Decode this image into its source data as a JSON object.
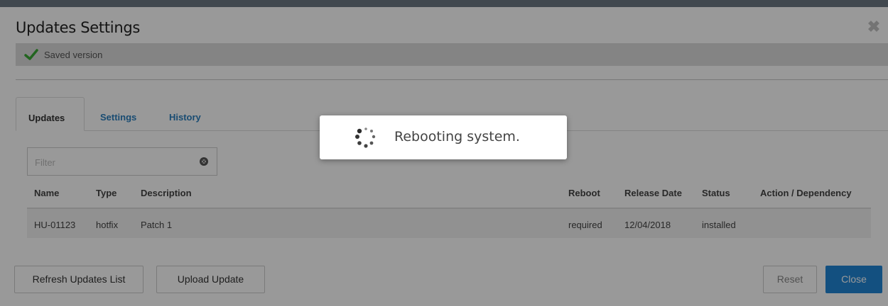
{
  "dialog": {
    "title": "Updates Settings",
    "saved_status": "Saved version"
  },
  "tabs": [
    {
      "label": "Updates",
      "active": true
    },
    {
      "label": "Settings",
      "active": false
    },
    {
      "label": "History",
      "active": false
    }
  ],
  "filter": {
    "placeholder": "Filter",
    "value": ""
  },
  "table": {
    "columns": [
      "Name",
      "Type",
      "Description",
      "Reboot",
      "Release Date",
      "Status",
      "Action / Dependency"
    ],
    "rows": [
      {
        "name": "HU-01123",
        "type": "hotfix",
        "description": "Patch 1",
        "reboot": "required",
        "release_date": "12/04/2018",
        "status": "installed",
        "action": ""
      }
    ]
  },
  "buttons": {
    "refresh": "Refresh Updates List",
    "upload": "Upload Update",
    "reset": "Reset",
    "close": "Close"
  },
  "overlay": {
    "message": "Rebooting system."
  },
  "colors": {
    "accent": "#2186d6",
    "success": "#3aa935",
    "backdrop": "rgba(0,0,0,0.4)"
  },
  "icons": {
    "close": "close-icon",
    "check": "checkmark-icon",
    "clear": "clear-filter-icon",
    "spinner": "spinner-icon"
  }
}
